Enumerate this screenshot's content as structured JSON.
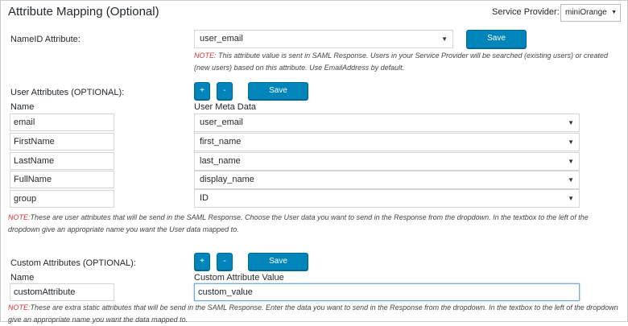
{
  "title": "Attribute Mapping (Optional)",
  "service_provider": {
    "label": "Service Provider:",
    "value": "miniOrange"
  },
  "nameid": {
    "label": "NameID Attribute:",
    "value": "user_email",
    "save_label": "Save",
    "note_tag": "NOTE:",
    "note_text": " This attribute value is sent in SAML Response. Users in your Service Provider will be searched (existing users) or created (new users) based on this attribute. Use EmailAddress by default."
  },
  "user_attributes": {
    "label": "User Attributes (OPTIONAL):",
    "add_label": "+",
    "remove_label": "-",
    "save_label": "Save",
    "col_name": "Name",
    "col_meta": "User Meta Data",
    "rows": [
      {
        "name": "email",
        "meta": "user_email"
      },
      {
        "name": "FirstName",
        "meta": "first_name"
      },
      {
        "name": "LastName",
        "meta": "last_name"
      },
      {
        "name": "FullName",
        "meta": "display_name"
      },
      {
        "name": "group",
        "meta": "ID"
      }
    ],
    "note_tag": "NOTE:",
    "note_text": "These are user attributes that will be send in the SAML Response. Choose the User data you want to send in the Response from the dropdown. In the textbox to the left of the dropdown give an appropriate name you want the User data mapped to."
  },
  "custom_attributes": {
    "label": "Custom Attributes (OPTIONAL):",
    "add_label": "+",
    "remove_label": "-",
    "save_label": "Save",
    "col_name": "Name",
    "col_value": "Custom Attribute Value",
    "row": {
      "name": "customAttribute",
      "value": "custom_value"
    },
    "note_tag": "NOTE:",
    "note_text": "These are extra static attributes that will be send in the SAML Response. Enter the data you want to send in the Response from the dropdown. In the textbox to the left of the dropdown give an appropriate name you want the data mapped to."
  },
  "icons": {
    "dropdown": "chevron-down-icon"
  }
}
